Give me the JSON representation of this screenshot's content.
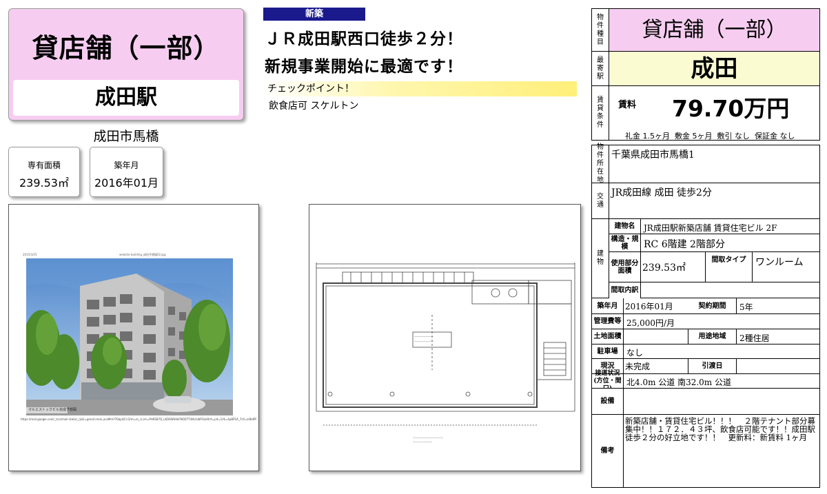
{
  "title_card": {
    "type": "貸店舗（一部）",
    "station": "成田駅"
  },
  "district": "成田市馬橋",
  "area_card": {
    "label": "専有面積",
    "value": "239.53㎡"
  },
  "built_card": {
    "label": "築年月",
    "value": "2016年01月"
  },
  "header": {
    "badge": "新築",
    "line1": "ＪＲ成田駅西口徒歩２分！",
    "line2": "新規事業開始に最適です！",
    "checkpoint_label": "チェックポイント！",
    "checkpoint_items": "飲食店可 スケルトン"
  },
  "photo": {
    "date": "2015/3/25",
    "filename": "website-building_成田予想図02.jpg",
    "caption": "マルエストックビル完成予想図",
    "url": "https://mail.google.com/_/scs/mail-static/_/js/k=gmail.main.ja.bMmY7EbpQCI.O/m=m_i,t,im=PH6SB7D_LKD6W04bFNOD7T4KLtUbPGLbR/rt=j/d=1/lk=4pBP2A_7r/t=zd6dPF9b9VQ3oKsJVmTpj5c4VaQ/ 1/1",
    "page": "1/1"
  },
  "right_table": {
    "type_label": "物件種目",
    "type_value": "貸店舗（一部）",
    "station_label": "最寄駅",
    "station_value": "成田",
    "terms_label": "賃貸条件",
    "rent_label": "賃料",
    "rent_value": "79.70万円",
    "fees": "礼金 1.5ヶ月  敷金 5ヶ月  敷引 なし  保証金 なし",
    "location_label": "物件所在地",
    "location_value": "千葉県成田市馬橋1",
    "access_label": "交通",
    "access_value": "JR成田線 成田 徒歩2分",
    "building_label": "建物",
    "bname_label": "建物名",
    "bname_value": "JR成田駅新築店舗 賃貸住宅ビル 2F",
    "structure_label": "構造・規模",
    "structure_value": "RC 6階建 2階部分",
    "usage_area_label": "使用部分面積",
    "usage_area_value": "239.53㎡",
    "layout_type_label": "間取タイプ",
    "layout_type_value": "ワンルーム",
    "layout_detail_label": "間取内訳",
    "layout_detail_value": "",
    "built_label": "築年月",
    "built_value": "2016年01月",
    "contract_label": "契約期間",
    "contract_value": "5年",
    "mgmt_label": "管理費等",
    "mgmt_value": "25,000円/月",
    "land_label": "土地面積",
    "land_value": "",
    "zone_label": "用途地域",
    "zone_value": "2種住居",
    "parking_label": "駐車場",
    "parking_value": "なし",
    "status_label": "現況",
    "status_value": "未完成",
    "handover_label": "引渡日",
    "handover_value": "",
    "road_label": "接道状況(方位・間口)",
    "road_value": "北4.0m 公道  南32.0m 公道",
    "equip_label": "設備",
    "equip_value": "",
    "remarks_label": "備考",
    "remarks_value": "新築店舗・賃貸住宅ビル！！！　２階テナント部分募集中！！１７２．４３坪、飲食店可能です！！成田駅徒歩２分の好立地です！！　更新料：新賃料 1ヶ月"
  }
}
